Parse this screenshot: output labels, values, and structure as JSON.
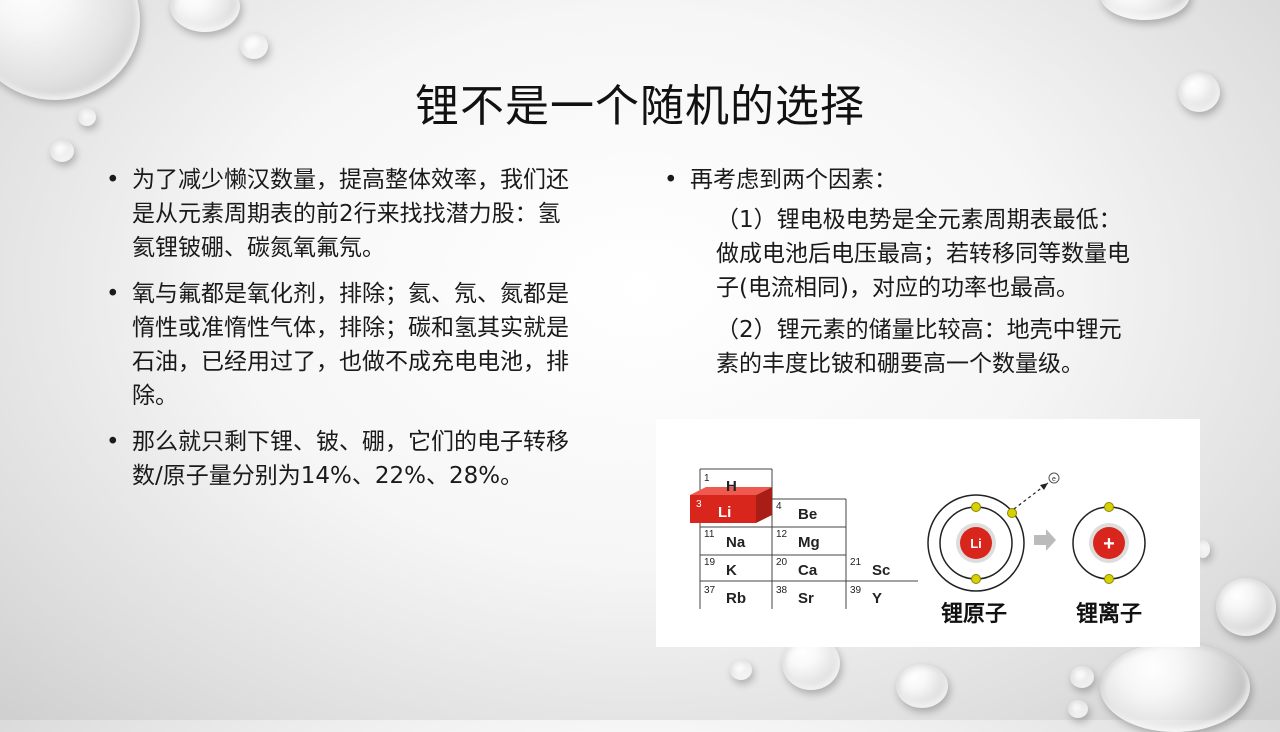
{
  "slide": {
    "title": "锂不是一个随机的选择"
  },
  "left_bullets": [
    "为了减少懒汉数量，提高整体效率，我们还是从元素周期表的前2行来找找潜力股：氢氦锂铍硼、碳氮氧氟氖。",
    "氧与氟都是氧化剂，排除；氦、氖、氮都是惰性或准惰性气体，排除；碳和氢其实就是石油，已经用过了，也做不成充电电池，排除。",
    "那么就只剩下锂、铍、硼，它们的电子转移数/原子量分别为14%、22%、28%。"
  ],
  "right": {
    "bullet": "再考虑到两个因素：",
    "factors": [
      "（1）锂电极电势是全元素周期表最低：做成电池后电压最高；若转移同等数量电子(电流相同)，对应的功率也最高。",
      "（2）锂元素的储量比较高：地壳中锂元素的丰度比铍和硼要高一个数量级。"
    ]
  },
  "figure": {
    "elements": [
      {
        "num": "1",
        "sym": "H"
      },
      {
        "num": "3",
        "sym": "Li"
      },
      {
        "num": "4",
        "sym": "Be"
      },
      {
        "num": "11",
        "sym": "Na"
      },
      {
        "num": "12",
        "sym": "Mg"
      },
      {
        "num": "19",
        "sym": "K"
      },
      {
        "num": "20",
        "sym": "Ca"
      },
      {
        "num": "21",
        "sym": "Sc"
      },
      {
        "num": "37",
        "sym": "Rb"
      },
      {
        "num": "38",
        "sym": "Sr"
      },
      {
        "num": "39",
        "sym": "Y"
      }
    ],
    "atom_core_label": "Li",
    "electron_label": "e",
    "ion_core_label": "+",
    "atom_caption": "锂原子",
    "ion_caption": "锂离子",
    "colors": {
      "lithium_red": "#d9261c",
      "electron_yellow": "#d8d000",
      "arrow_gray": "#bbbbbb"
    }
  }
}
